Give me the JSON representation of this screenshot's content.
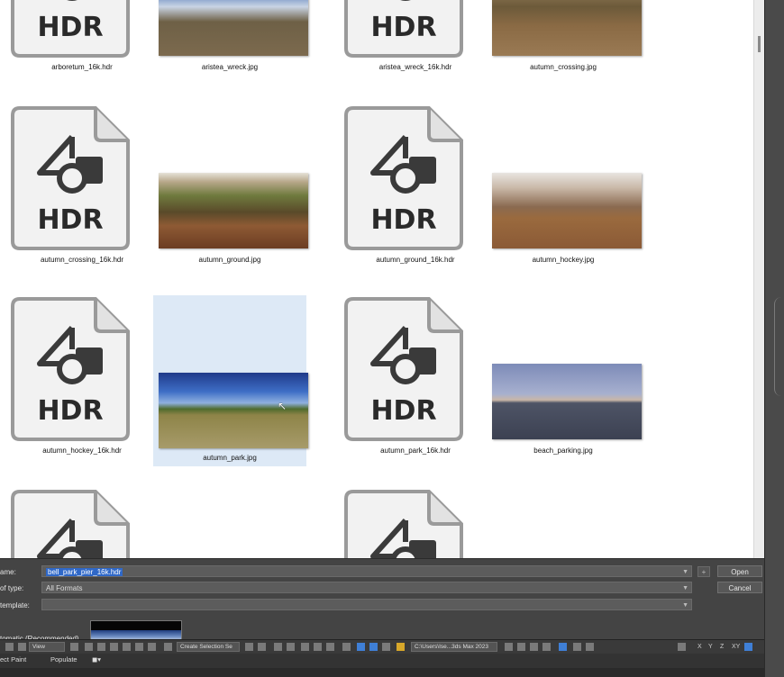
{
  "files": [
    {
      "name": "arboretum_16k.hdr",
      "kind": "hdr"
    },
    {
      "name": "aristea_wreck.jpg",
      "kind": "jpg",
      "thumb": "t-wreck"
    },
    {
      "name": "aristea_wreck_16k.hdr",
      "kind": "hdr"
    },
    {
      "name": "autumn_crossing.jpg",
      "kind": "jpg",
      "thumb": "t-crossing"
    },
    {
      "name": "autumn_crossing_16k.hdr",
      "kind": "hdr"
    },
    {
      "name": "autumn_ground.jpg",
      "kind": "jpg",
      "thumb": "t-forest2"
    },
    {
      "name": "autumn_ground_16k.hdr",
      "kind": "hdr"
    },
    {
      "name": "autumn_hockey.jpg",
      "kind": "jpg",
      "thumb": "t-hockey"
    },
    {
      "name": "autumn_hockey_16k.hdr",
      "kind": "hdr"
    },
    {
      "name": "autumn_park.jpg",
      "kind": "jpg",
      "thumb": "t-park",
      "selected": true
    },
    {
      "name": "autumn_park_16k.hdr",
      "kind": "hdr"
    },
    {
      "name": "beach_parking.jpg",
      "kind": "jpg",
      "thumb": "t-beach"
    }
  ],
  "icon_text": "HDR",
  "dialog": {
    "filename_label": "ame:",
    "filename_value": "bell_park_pier_16k.hdr",
    "type_label": "of type:",
    "type_value": "All Formats",
    "template_label": "template:",
    "template_value": "",
    "open_label": "Open",
    "cancel_label": "Cancel",
    "plus_label": "+",
    "gamma_label": "tomatic (Recommended)"
  },
  "toolbar": {
    "view_label": "View",
    "selection_set_label": "Create Selection Se",
    "path_label": "C:\\Users\\Ise...3ds Max 2023",
    "axis_x": "X",
    "axis_y": "Y",
    "axis_z": "Z",
    "axis_xy": "XY"
  },
  "status": {
    "paint_label": "ect Paint",
    "populate_label": "Populate"
  },
  "colors": {
    "selection": "#dde9f6",
    "highlight": "#2f68c8",
    "icon_dark": "#3a3a3a",
    "icon_page": "#f2f2f2"
  }
}
